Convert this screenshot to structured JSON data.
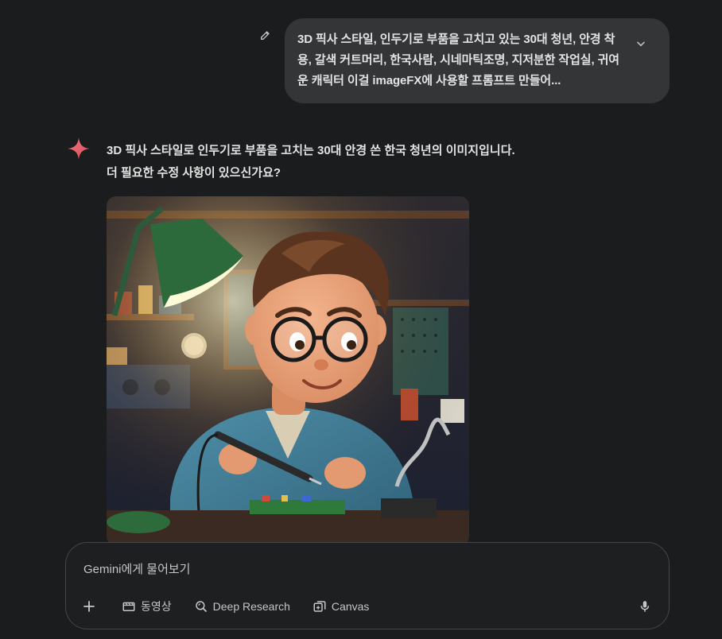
{
  "user_message": {
    "text": "3D 픽사 스타일, 인두기로 부품을 고치고 있는 30대 청년, 안경 착용, 갈색  커트머리, 한국사람, 시네마틱조명, 지저분한 작업실, 귀여운 캐릭터 이걸 imageFX에 사용할 프롬프트 만들어...",
    "edit_icon": "pencil-icon",
    "expand_icon": "chevron-down-icon"
  },
  "assistant_message": {
    "avatar_icon": "gemini-spark-icon",
    "line1": "3D 픽사 스타일로 인두기로 부품을 고치는 30대 안경 쓴 한국 청년의 이미지입니다.",
    "line2": "더 필요한 수정 사항이 있으신가요?"
  },
  "composer": {
    "placeholder": "Gemini에게 물어보기",
    "value": "",
    "tools": [
      {
        "label": "동영상",
        "icon": "video-icon"
      },
      {
        "label": "Deep Research",
        "icon": "deep-research-icon"
      },
      {
        "label": "Canvas",
        "icon": "canvas-icon"
      }
    ],
    "add_icon": "plus-icon",
    "mic_icon": "microphone-icon"
  },
  "colors": {
    "background": "#1b1c1d",
    "bubble": "#333537",
    "composer_border": "#444746",
    "text": "#e3e3e3",
    "muted": "#c4c7c5",
    "spark_red": "#e8606d"
  }
}
